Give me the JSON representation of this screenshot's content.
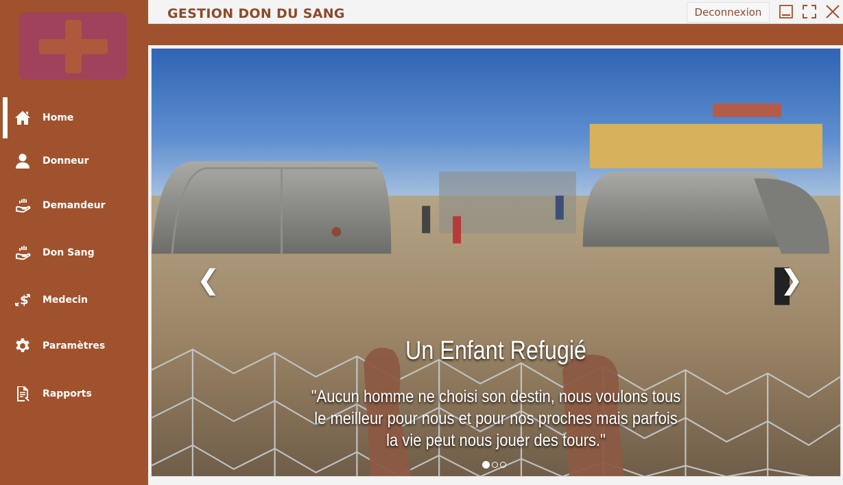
{
  "app": {
    "title": "GESTION DON DU SANG",
    "logout_label": "Deconnexion"
  },
  "colors": {
    "brand": "#a0522d",
    "title": "#8b4a2b",
    "logo": "#a0425b"
  },
  "sidebar": {
    "items": [
      {
        "label": "Home",
        "icon": "home-icon",
        "active": true
      },
      {
        "label": "Donneur",
        "icon": "user-icon"
      },
      {
        "label": "Demandeur",
        "icon": "hand-icon"
      },
      {
        "label": "Don Sang",
        "icon": "hand-icon"
      },
      {
        "label": "Medecin",
        "icon": "money-exchange-icon"
      },
      {
        "label": "Paramètres",
        "icon": "gear-icon"
      },
      {
        "label": "Rapports",
        "icon": "report-icon"
      }
    ]
  },
  "carousel": {
    "title": "Un Enfant Refugié",
    "text": "\"Aucun homme ne choisi son destin, nous voulons tous le meilleur pour nous et pour nos proches mais parfois la vie peut nous jouer des tours.\"",
    "prev_symbol": "❮",
    "next_symbol": "❯",
    "slide_count": 3,
    "active_index": 0
  }
}
